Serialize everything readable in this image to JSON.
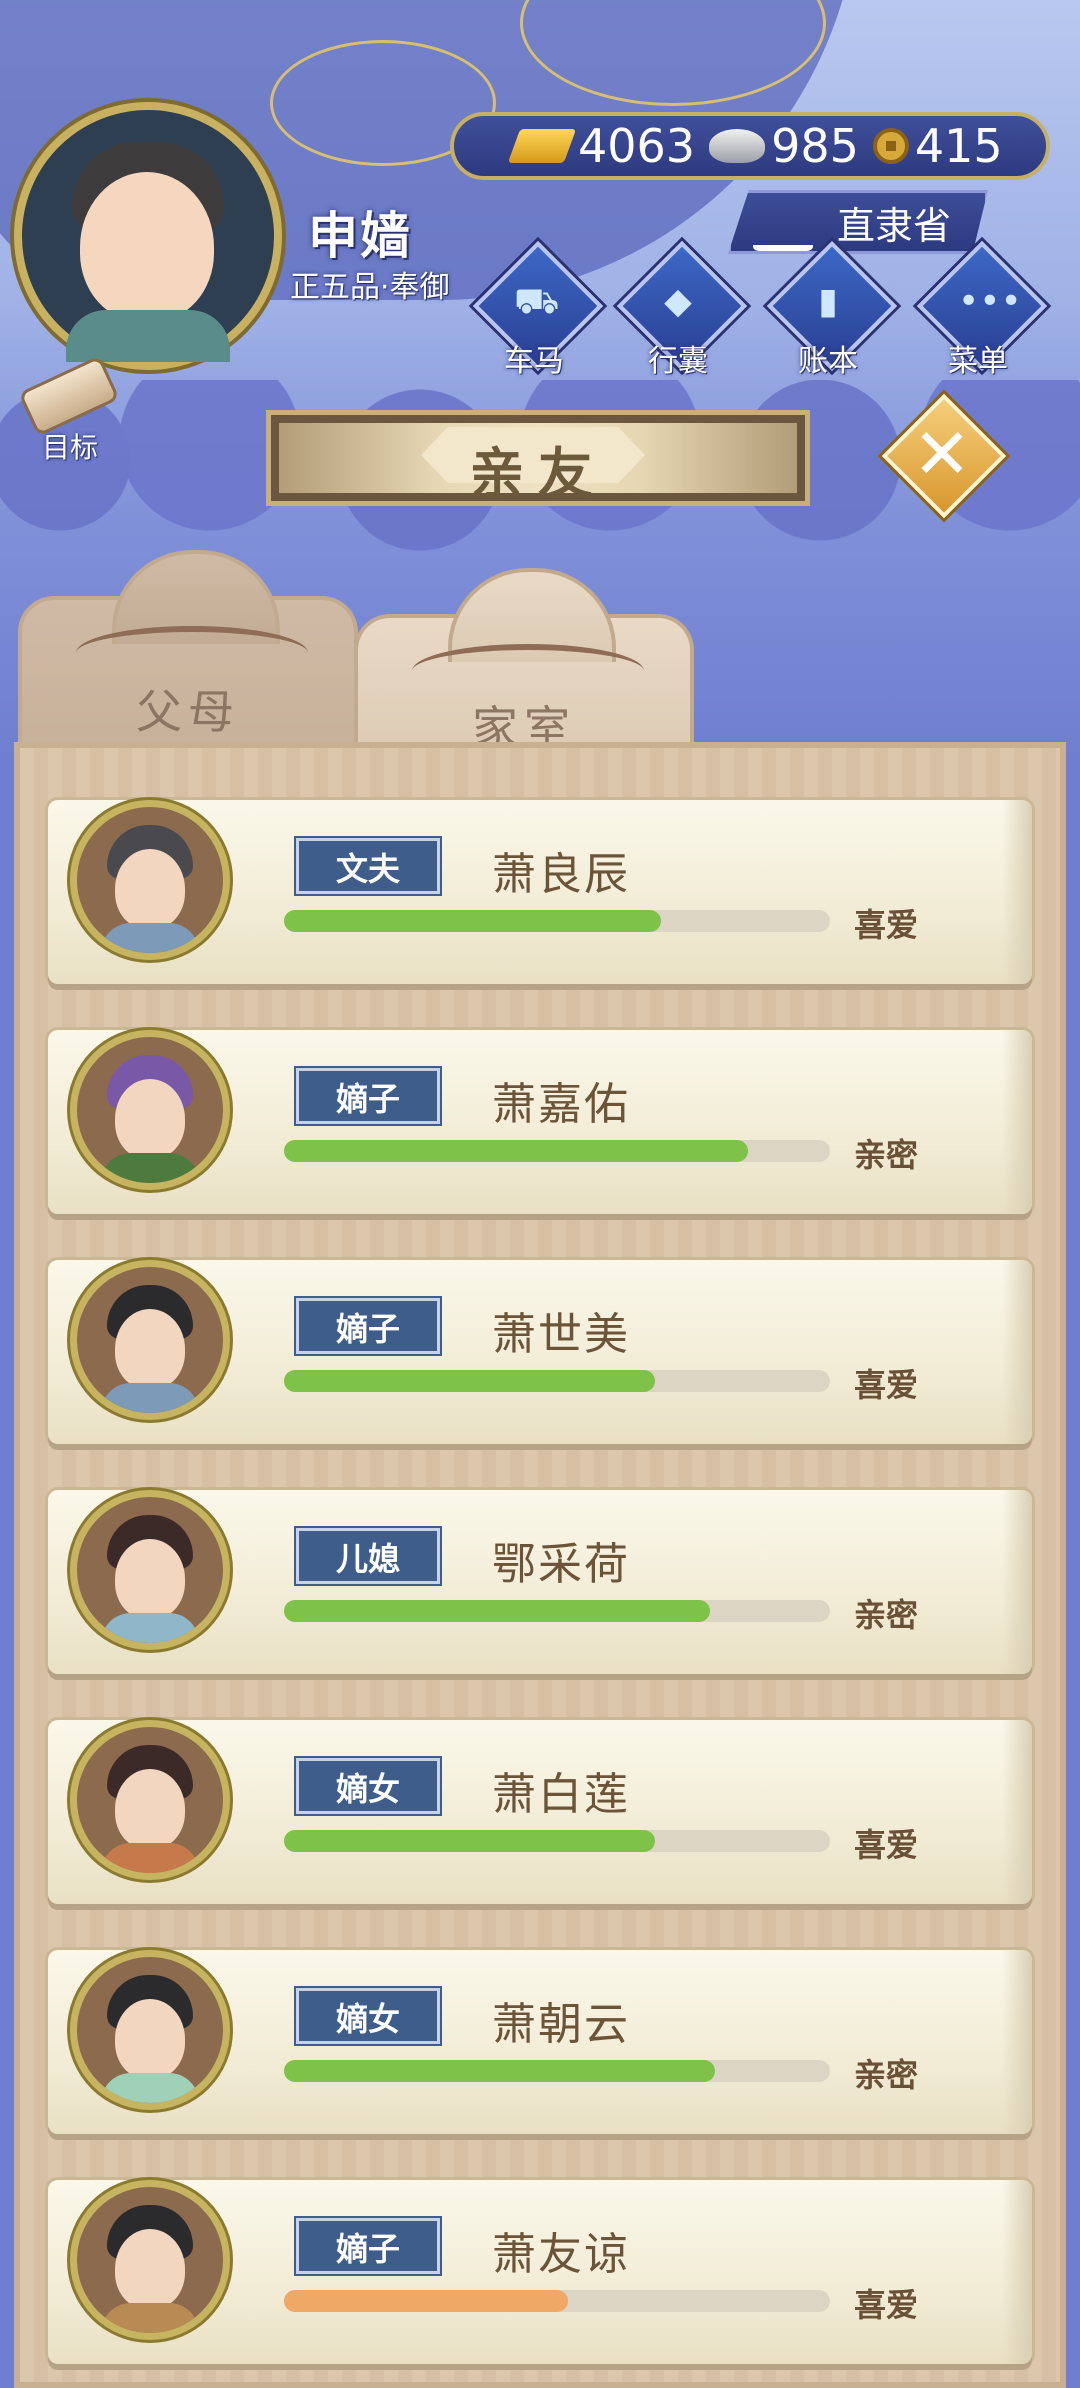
{
  "player": {
    "name": "申嫱",
    "title": "正五品·奉御"
  },
  "currency": {
    "gold": "4063",
    "silver": "985",
    "coin": "415"
  },
  "location": "直隶省",
  "menu": [
    {
      "label": "车马",
      "icon": "carriage-icon"
    },
    {
      "label": "行囊",
      "icon": "bag-icon"
    },
    {
      "label": "账本",
      "icon": "ledger-icon"
    },
    {
      "label": "菜单",
      "icon": "more-icon"
    }
  ],
  "goal_label": "目标",
  "page_title": "亲友",
  "tabs": [
    {
      "label": "父母",
      "active": false
    },
    {
      "label": "家室",
      "active": true
    }
  ],
  "members": [
    {
      "role": "文夫",
      "name": "萧良辰",
      "status": "喜爱",
      "affinity_pct": 69,
      "bar_color": "#7fc24a",
      "hair": "#4a4a4e",
      "clothes": "#7d9ab8"
    },
    {
      "role": "嫡子",
      "name": "萧嘉佑",
      "status": "亲密",
      "affinity_pct": 85,
      "bar_color": "#7fc24a",
      "hair": "#7a58a8",
      "clothes": "#4d7a3d"
    },
    {
      "role": "嫡子",
      "name": "萧世美",
      "status": "喜爱",
      "affinity_pct": 68,
      "bar_color": "#7fc24a",
      "hair": "#2b2a2c",
      "clothes": "#7d9ab8"
    },
    {
      "role": "儿媳",
      "name": "鄂采荷",
      "status": "亲密",
      "affinity_pct": 78,
      "bar_color": "#7fc24a",
      "hair": "#3b2a28",
      "clothes": "#8fb6c9"
    },
    {
      "role": "嫡女",
      "name": "萧白莲",
      "status": "喜爱",
      "affinity_pct": 68,
      "bar_color": "#7fc24a",
      "hair": "#3b2a28",
      "clothes": "#c67a4c"
    },
    {
      "role": "嫡女",
      "name": "萧朝云",
      "status": "亲密",
      "affinity_pct": 79,
      "bar_color": "#7fc24a",
      "hair": "#2b2a2c",
      "clothes": "#9fd0b8"
    },
    {
      "role": "嫡子",
      "name": "萧友谅",
      "status": "喜爱",
      "affinity_pct": 52,
      "bar_color": "#f0a866",
      "hair": "#2b2a2c",
      "clothes": "#b88a54"
    }
  ]
}
